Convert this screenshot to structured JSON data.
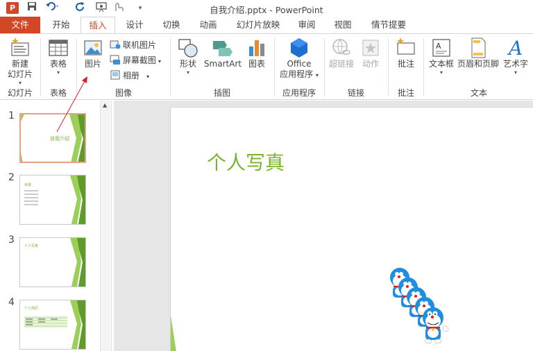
{
  "window": {
    "app_logo": "P",
    "title": "自我介绍.pptx - PowerPoint"
  },
  "quick_access": {
    "save_icon": "save-icon",
    "undo_icon": "undo-icon",
    "redo_icon": "redo-icon",
    "touch_mode_icon": "touch-mode-icon",
    "customize_icon": "customize-qat-icon"
  },
  "tabs": [
    {
      "label": "文件"
    },
    {
      "label": "开始"
    },
    {
      "label": "插入"
    },
    {
      "label": "设计"
    },
    {
      "label": "切换"
    },
    {
      "label": "动画"
    },
    {
      "label": "幻灯片放映"
    },
    {
      "label": "审阅"
    },
    {
      "label": "视图"
    },
    {
      "label": "情节提要"
    }
  ],
  "ribbon": {
    "new_slide": {
      "line1": "新建",
      "line2": "幻灯片"
    },
    "table": {
      "label": "表格"
    },
    "picture": {
      "label": "图片"
    },
    "online_picture": {
      "label": "联机图片"
    },
    "screenshot": {
      "label": "屏幕截图"
    },
    "album": {
      "label": "相册"
    },
    "shapes": {
      "label": "形状"
    },
    "smartart": {
      "label": "SmartArt"
    },
    "chart": {
      "label": "图表"
    },
    "office_apps": {
      "line1": "Office",
      "line2": "应用程序"
    },
    "hyperlink": {
      "label": "超链接"
    },
    "action": {
      "label": "动作"
    },
    "comment": {
      "label": "批注"
    },
    "textbox": {
      "label": "文本框"
    },
    "header_footer": {
      "label": "页眉和页脚"
    },
    "wordart": {
      "label": "艺术字"
    },
    "groups": [
      {
        "label": "幻灯片"
      },
      {
        "label": "表格"
      },
      {
        "label": "图像"
      },
      {
        "label": "插图"
      },
      {
        "label": "应用程序"
      },
      {
        "label": "链接"
      },
      {
        "label": "批注"
      },
      {
        "label": "文本"
      }
    ]
  },
  "thumbnails": [
    {
      "number": "1",
      "text": "自我介绍",
      "selected": true
    },
    {
      "number": "2",
      "text": "目录",
      "selected": false
    },
    {
      "number": "3",
      "text": "个人写真",
      "selected": false
    },
    {
      "number": "4",
      "text": "个人简历",
      "selected": false
    }
  ],
  "slide": {
    "title": "个人写真",
    "image_name": "doraemon-picture"
  },
  "colors": {
    "accent": "#d24726",
    "slide_green": "#7ab52d"
  }
}
